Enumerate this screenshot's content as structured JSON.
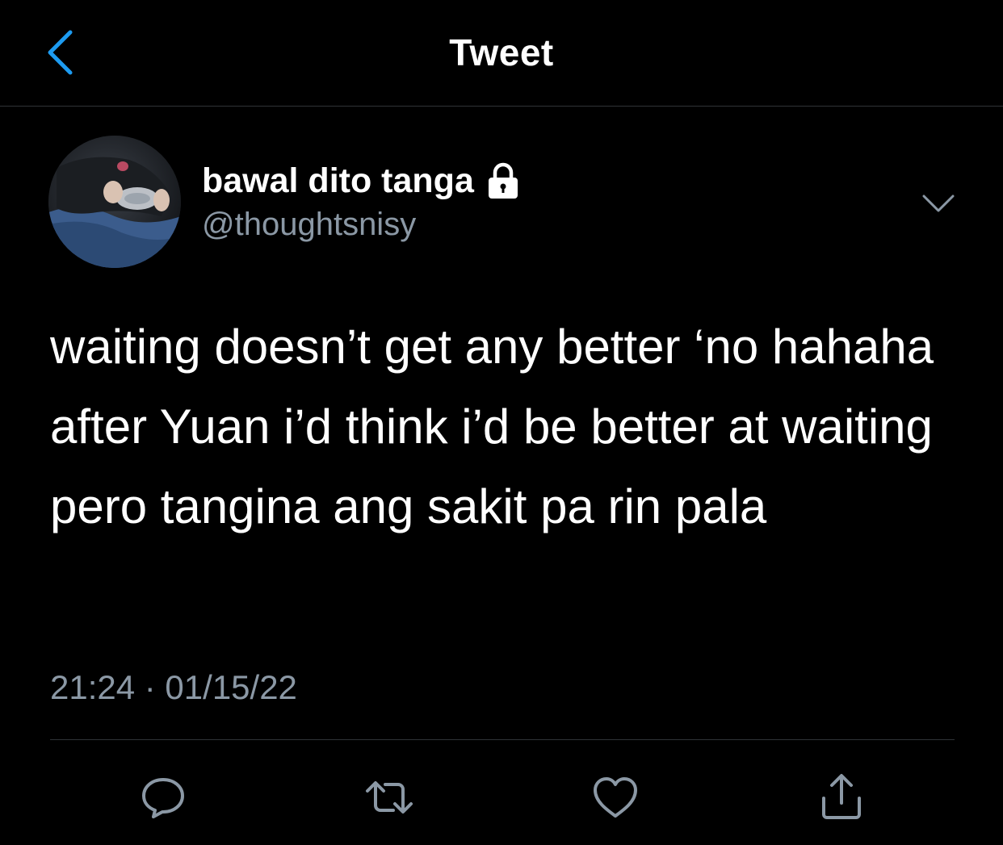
{
  "nav": {
    "title": "Tweet"
  },
  "author": {
    "display_name": "bawal dito tanga",
    "handle": "@thoughtsnisy"
  },
  "tweet": {
    "text": "waiting doesn’t get any better ‘no hahaha after Yuan i’d think i’d be better at waiting pero tangina ang sakit pa rin pala",
    "timestamp": "21:24 · 01/15/22"
  },
  "icons": {
    "back": "chevron-left-icon",
    "lock": "lock-icon",
    "caret": "chevron-down-icon",
    "reply": "reply-bubble-icon",
    "retweet": "retweet-icon",
    "like": "heart-icon",
    "share": "share-icon"
  },
  "colors": {
    "background": "#000000",
    "accent": "#1d9bf0",
    "secondary_text": "#8b98a5",
    "divider": "#2f3336"
  }
}
